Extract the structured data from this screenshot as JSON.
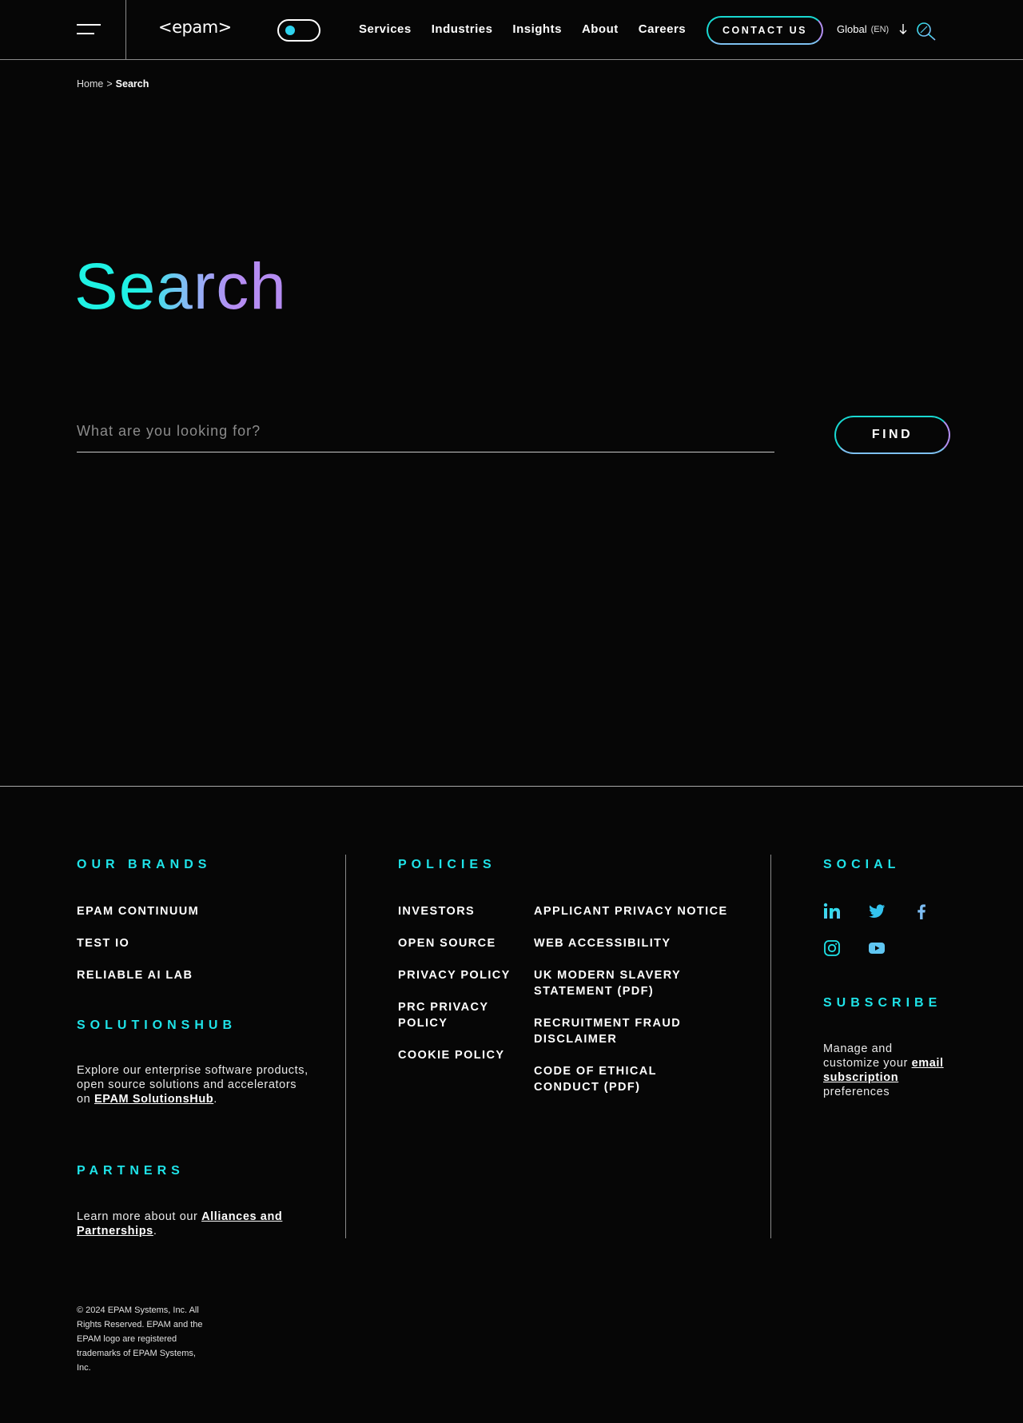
{
  "header": {
    "logo_text": "<epam>",
    "nav": [
      "Services",
      "Industries",
      "Insights",
      "About",
      "Careers"
    ],
    "contact_label": "CONTACT US",
    "region_label": "Global",
    "region_lang": "(EN)",
    "accent_color": "#1fe3e8",
    "secondary_accent": "#b58cf2"
  },
  "breadcrumb": {
    "home": "Home",
    "separator": ">",
    "current": "Search"
  },
  "hero": {
    "title": "Search",
    "search_placeholder": "What are you looking for?",
    "search_value": "",
    "find_label": "FIND"
  },
  "footer": {
    "brands": {
      "heading": "OUR BRANDS",
      "items": [
        "EPAM CONTINUUM",
        "TEST IO",
        "RELIABLE AI LAB"
      ]
    },
    "solutionshub": {
      "heading": "SOLUTIONSHUB",
      "text": "Explore our enterprise software products, open source solutions and accelerators on",
      "link": "EPAM SolutionsHub",
      "suffix": "."
    },
    "partners": {
      "heading": "PARTNERS",
      "text": "Learn more about our",
      "link": "Alliances and Partnerships",
      "suffix": "."
    },
    "policies": {
      "heading": "POLICIES",
      "col1": [
        "INVESTORS",
        "OPEN SOURCE",
        "PRIVACY POLICY",
        "PRC PRIVACY POLICY",
        "COOKIE POLICY"
      ],
      "col2": [
        "APPLICANT PRIVACY NOTICE",
        "WEB ACCESSIBILITY",
        "UK MODERN SLAVERY STATEMENT (PDF)",
        "RECRUITMENT FRAUD DISCLAIMER",
        "CODE OF ETHICAL CONDUCT (PDF)"
      ]
    },
    "social": {
      "heading": "SOCIAL",
      "icons": [
        "linkedin-icon",
        "twitter-icon",
        "facebook-icon",
        "instagram-icon",
        "youtube-icon"
      ]
    },
    "subscribe": {
      "heading": "SUBSCRIBE",
      "text_before": "Manage and customize your",
      "link": "email subscription",
      "text_after": "preferences"
    },
    "copyright": "© 2024 EPAM Systems, Inc. All Rights Reserved. EPAM and the EPAM logo are registered trademarks of EPAM Systems, Inc."
  }
}
